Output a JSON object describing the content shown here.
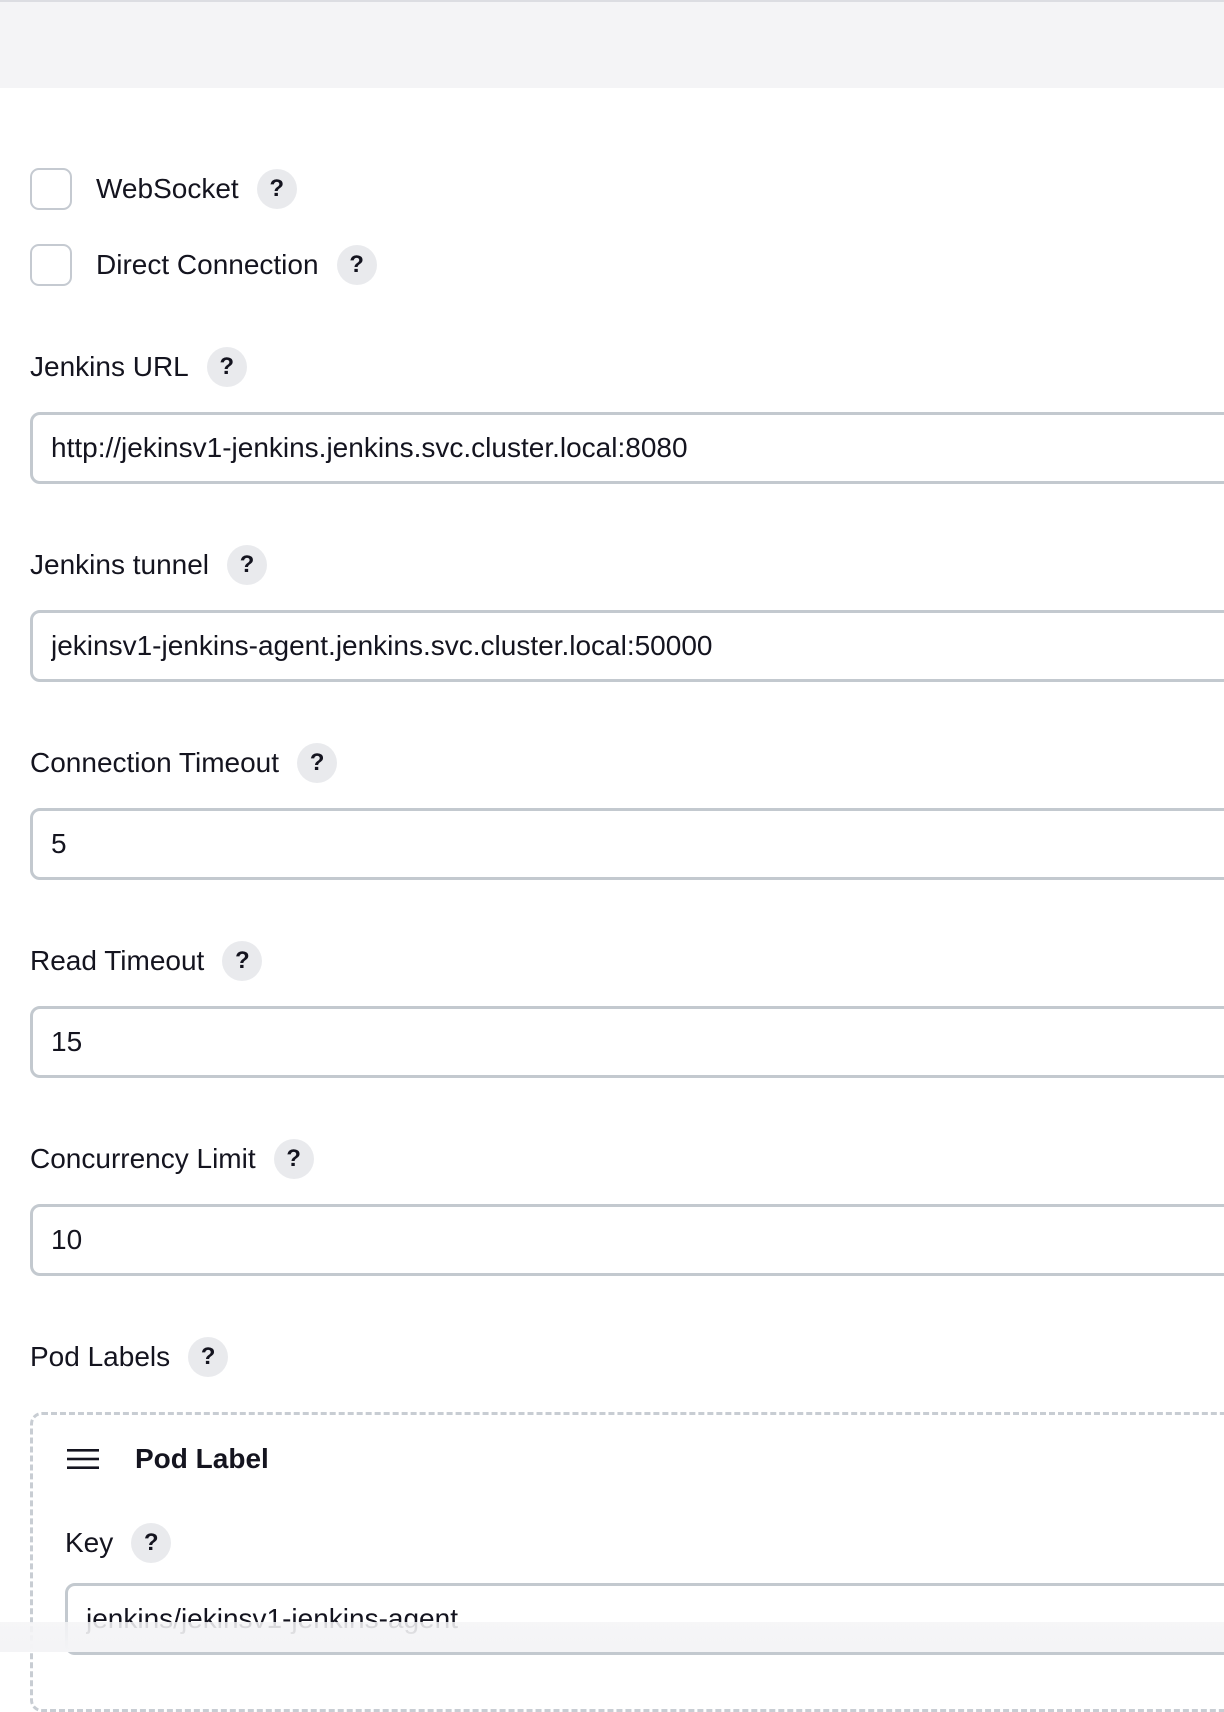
{
  "options": {
    "websocket": {
      "label": "WebSocket",
      "checked": false,
      "help": "?"
    },
    "direct_connection": {
      "label": "Direct Connection",
      "checked": false,
      "help": "?"
    }
  },
  "fields": {
    "jenkins_url": {
      "label": "Jenkins URL",
      "help": "?",
      "value": "http://jekinsv1-jenkins.jenkins.svc.cluster.local:8080"
    },
    "jenkins_tunnel": {
      "label": "Jenkins tunnel",
      "help": "?",
      "value": "jekinsv1-jenkins-agent.jenkins.svc.cluster.local:50000"
    },
    "connection_timeout": {
      "label": "Connection Timeout",
      "help": "?",
      "value": "5"
    },
    "read_timeout": {
      "label": "Read Timeout",
      "help": "?",
      "value": "15"
    },
    "concurrency_limit": {
      "label": "Concurrency Limit",
      "help": "?",
      "value": "10"
    }
  },
  "pod_labels": {
    "label": "Pod Labels",
    "help": "?",
    "items": [
      {
        "title": "Pod Label",
        "key_label": "Key",
        "key_help": "?",
        "key_value": "jenkins/jekinsv1-jenkins-agent"
      }
    ]
  },
  "icons": {
    "drag_handle": "drag-handle-icon",
    "help": "help-icon"
  },
  "colors": {
    "topbar_bg": "#f4f4f6",
    "help_bg": "#e9eaed",
    "input_border": "#c3c9cf",
    "text": "#14141f"
  }
}
